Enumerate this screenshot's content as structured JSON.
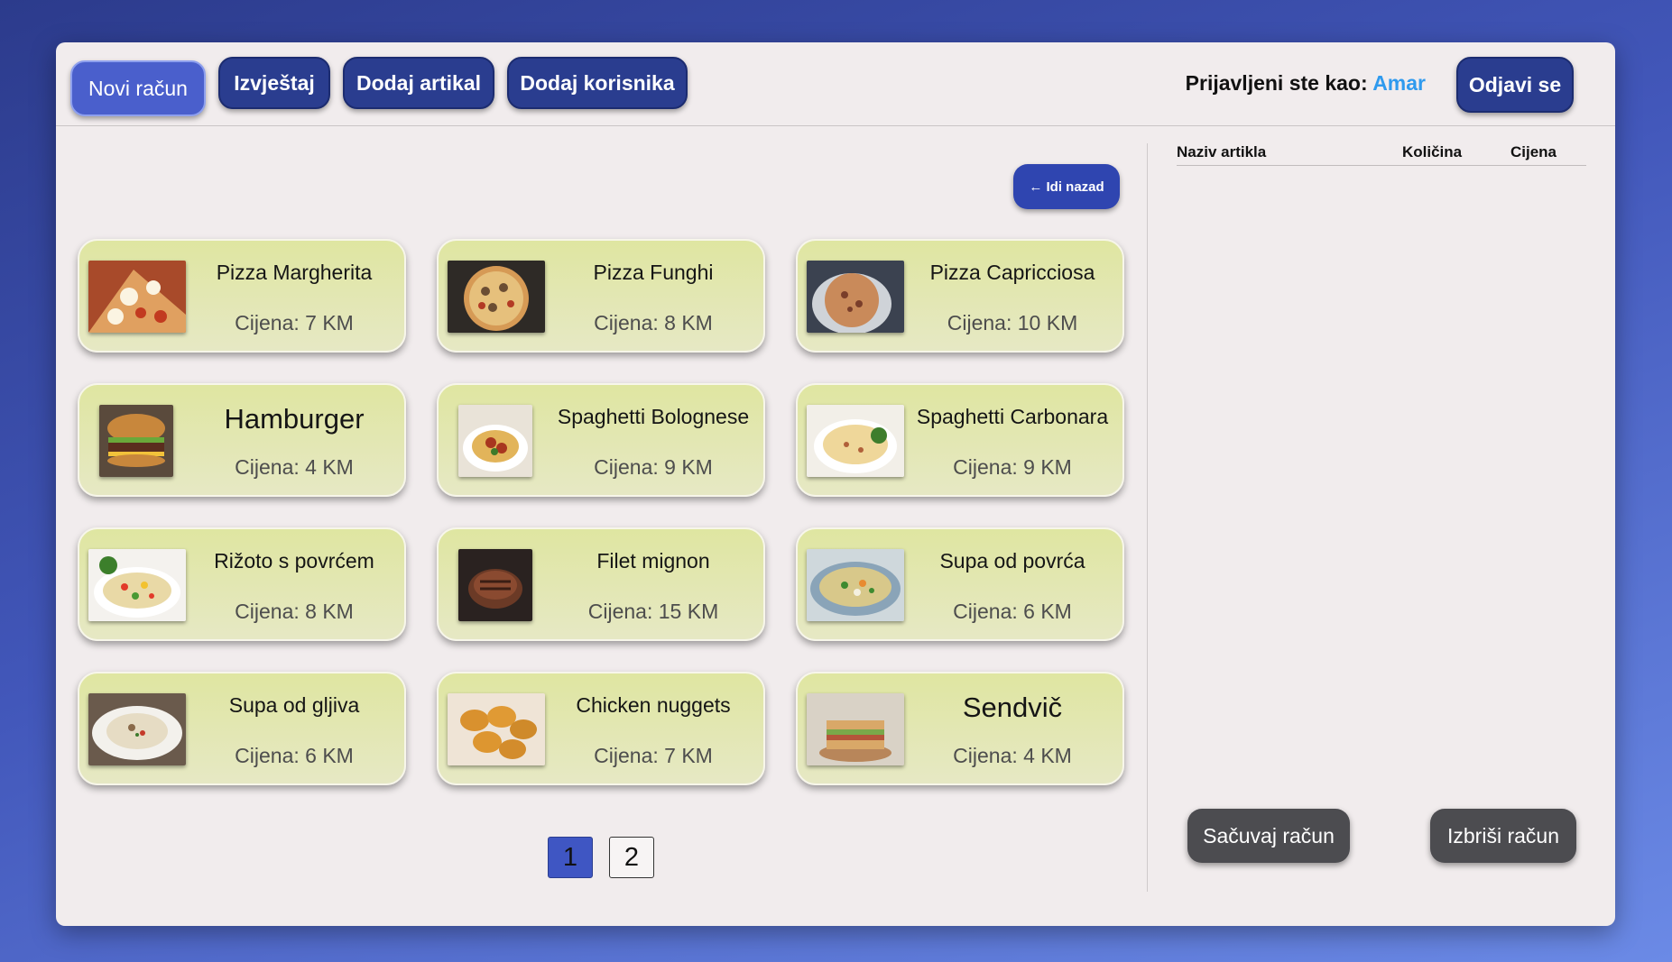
{
  "nav": {
    "new_bill": "Novi račun",
    "report": "Izvještaj",
    "add_item": "Dodaj artikal",
    "add_user": "Dodaj korisnika"
  },
  "user": {
    "logged_in_label": "Prijavljeni ste kao: ",
    "name": "Amar",
    "logout": "Odjavi se"
  },
  "back_button": "← Idi nazad",
  "items": [
    {
      "name": "Pizza Margherita",
      "price": "Cijena: 7 KM",
      "image": "pizza-margherita-image"
    },
    {
      "name": "Pizza Funghi",
      "price": "Cijena: 8 KM",
      "image": "pizza-funghi-image"
    },
    {
      "name": "Pizza Capricciosa",
      "price": "Cijena: 10 KM",
      "image": "pizza-capricciosa-image"
    },
    {
      "name": "Hamburger",
      "price": "Cijena: 4 KM",
      "image": "hamburger-image"
    },
    {
      "name": "Spaghetti Bolognese",
      "price": "Cijena: 9 KM",
      "image": "spaghetti-bolognese-image"
    },
    {
      "name": "Spaghetti Carbonara",
      "price": "Cijena: 9 KM",
      "image": "spaghetti-carbonara-image"
    },
    {
      "name": "Rižoto s povrćem",
      "price": "Cijena: 8 KM",
      "image": "rizoto-image"
    },
    {
      "name": "Filet mignon",
      "price": "Cijena: 15 KM",
      "image": "filet-mignon-image"
    },
    {
      "name": "Supa od povrća",
      "price": "Cijena: 6 KM",
      "image": "vegetable-soup-image"
    },
    {
      "name": "Supa od gljiva",
      "price": "Cijena: 6 KM",
      "image": "mushroom-soup-image"
    },
    {
      "name": "Chicken nuggets",
      "price": "Cijena: 7 KM",
      "image": "chicken-nuggets-image"
    },
    {
      "name": "Sendvič",
      "price": "Cijena: 4 KM",
      "image": "sandwich-image"
    }
  ],
  "pagination": {
    "pages": [
      "1",
      "2"
    ],
    "current": "1"
  },
  "bill_table": {
    "col_name": "Naziv artikla",
    "col_qty": "Količina",
    "col_price": "Cijena",
    "rows": []
  },
  "actions": {
    "save": "Sačuvaj račun",
    "delete": "Izbriši račun"
  },
  "colors": {
    "nav_button": "#2a3d8f",
    "accent_user": "#2f9aee",
    "card_bg": "#dfe6a1",
    "action_button": "#4c4c50"
  }
}
